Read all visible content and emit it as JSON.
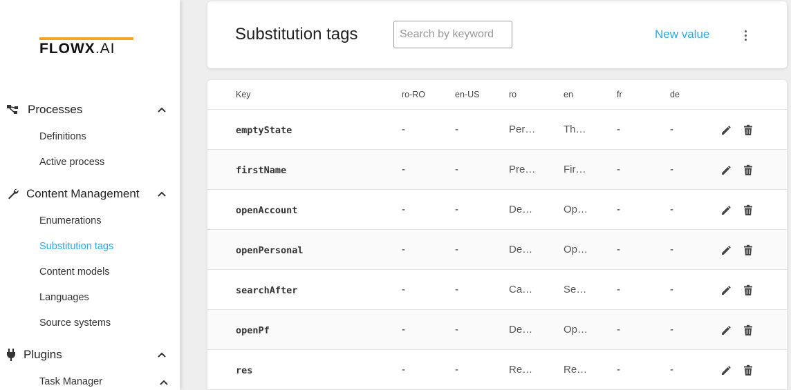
{
  "brand": {
    "logo_bold": "FLOWX",
    "logo_light": ".AI",
    "accent": "#f5a623"
  },
  "sidebar": {
    "sections": [
      {
        "label": "Processes",
        "icon": "flow-icon",
        "items": [
          {
            "label": "Definitions"
          },
          {
            "label": "Active process"
          }
        ]
      },
      {
        "label": "Content Management",
        "icon": "wrench-icon",
        "items": [
          {
            "label": "Enumerations"
          },
          {
            "label": "Substitution tags",
            "active": true
          },
          {
            "label": "Content models"
          },
          {
            "label": "Languages"
          },
          {
            "label": "Source systems"
          }
        ]
      },
      {
        "label": "Plugins",
        "icon": "plug-icon",
        "items": [
          {
            "label": "Task Manager"
          }
        ]
      }
    ]
  },
  "header": {
    "title": "Substitution tags",
    "search_placeholder": "Search by keyword",
    "new_value_label": "New value"
  },
  "table": {
    "columns": [
      "Key",
      "ro-RO",
      "en-US",
      "ro",
      "en",
      "fr",
      "de"
    ],
    "rows": [
      [
        "emptyState",
        "-",
        "-",
        "Per…",
        "Th…",
        "-",
        "-"
      ],
      [
        "firstName",
        "-",
        "-",
        "Pre…",
        "Fir…",
        "-",
        "-"
      ],
      [
        "openAccount",
        "-",
        "-",
        "De…",
        "Op…",
        "-",
        "-"
      ],
      [
        "openPersonal",
        "-",
        "-",
        "De…",
        "Op…",
        "-",
        "-"
      ],
      [
        "searchAfter",
        "-",
        "-",
        "Ca…",
        "Se…",
        "-",
        "-"
      ],
      [
        "openPf",
        "-",
        "-",
        "De…",
        "Op…",
        "-",
        "-"
      ],
      [
        "res",
        "-",
        "-",
        "Re…",
        "Re…",
        "-",
        "-"
      ]
    ]
  },
  "colors": {
    "link": "#29a9e6",
    "active": "#29a9e6"
  }
}
